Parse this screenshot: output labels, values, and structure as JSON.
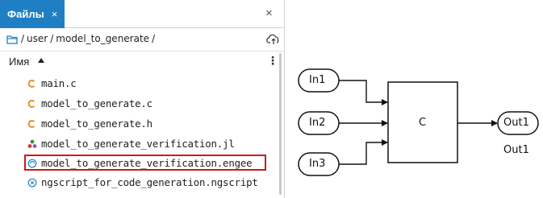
{
  "tab": {
    "title": "Файлы",
    "close": "×"
  },
  "panel_close": "×",
  "path": {
    "segments": [
      "/",
      "user",
      "/",
      "model_to_generate",
      "/"
    ]
  },
  "column": {
    "name": "Имя",
    "menu": "⋮"
  },
  "files": [
    {
      "name": "main.c",
      "icon": "c-file-icon",
      "color": "#e8912d"
    },
    {
      "name": "model_to_generate.c",
      "icon": "c-file-icon",
      "color": "#e8912d"
    },
    {
      "name": "model_to_generate.h",
      "icon": "c-file-icon",
      "color": "#e8912d"
    },
    {
      "name": "model_to_generate_verification.jl",
      "icon": "julia-file-icon",
      "color": "#9558b2"
    },
    {
      "name": "model_to_generate_verification.engee",
      "icon": "engee-model-icon",
      "color": "#1f7fc4",
      "highlighted": true
    },
    {
      "name": "ngscript_for_code_generation.ngscript",
      "icon": "ngscript-file-icon",
      "color": "#1f7fc4"
    }
  ],
  "diagram": {
    "inputs": [
      "In1",
      "In2",
      "In3"
    ],
    "block": "C",
    "output": "Out1",
    "output_caption": "Out1"
  },
  "colors": {
    "accent": "#1f7fc4",
    "highlight": "#d01818"
  }
}
